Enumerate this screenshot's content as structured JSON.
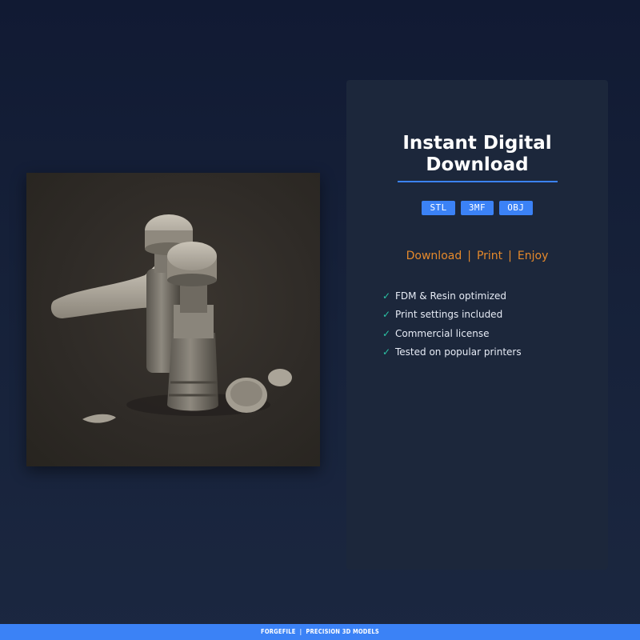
{
  "product": {
    "image_alt": "3D printed model render"
  },
  "card": {
    "title": "Instant Digital\nDownload",
    "formats": [
      "STL",
      "3MF",
      "OBJ"
    ],
    "steps": [
      "Download",
      "Print",
      "Enjoy"
    ],
    "step_separator": "|",
    "features": [
      "FDM & Resin optimized",
      "Print settings included",
      "Commercial license",
      "Tested on popular printers"
    ],
    "check_glyph": "✓"
  },
  "footer": {
    "text": "FORGEFILE  |  PRECISION 3D MODELS"
  },
  "colors": {
    "accent": "#3b82f6",
    "step_text": "#e5892b",
    "check": "#2bc4a5",
    "card_bg": "#1c273b"
  }
}
